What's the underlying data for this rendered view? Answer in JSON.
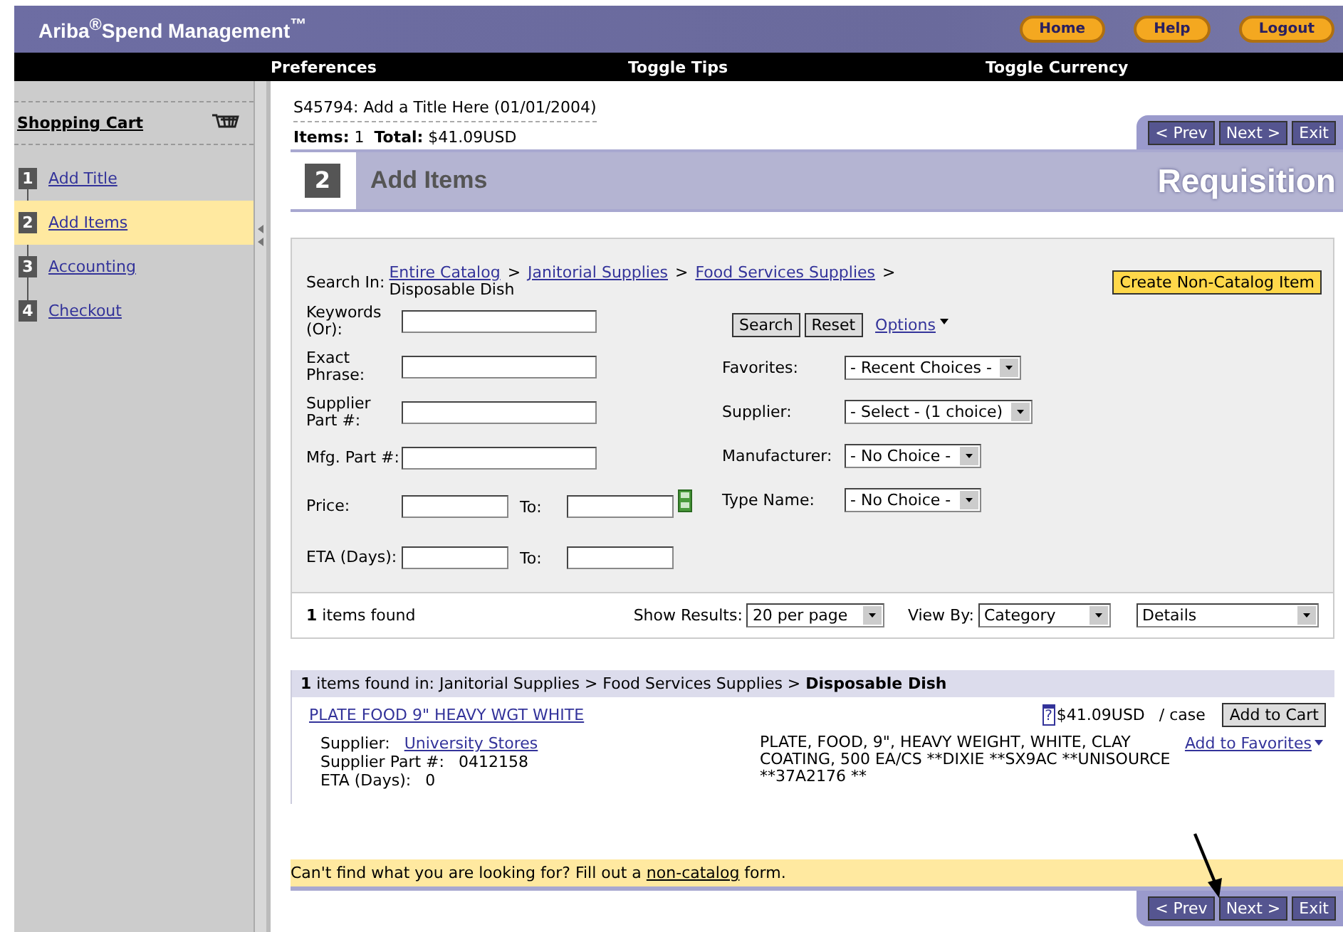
{
  "header": {
    "title": "Ariba$^{®}$Spend Management$^{™}$",
    "buttons": [
      "Home",
      "Help",
      "Logout"
    ]
  },
  "nav_bar": [
    "Preferences",
    "Toggle Tips",
    "Toggle Currency"
  ],
  "sidebar": {
    "title": "Shopping Cart",
    "steps": [
      {
        "number": "1",
        "label": "Add Title",
        "selected": false
      },
      {
        "number": "2",
        "label": "Add Items",
        "selected": true
      },
      {
        "number": "3",
        "label": "Accounting",
        "selected": false
      },
      {
        "number": "4",
        "label": "Checkout",
        "selected": false
      }
    ]
  },
  "document": {
    "title": "S45794: Add a Title Here (01/01/2004)",
    "summary": "**Items:** 1  **Total:** $41.09USD",
    "top_nav": [
      "< Prev",
      "Next >",
      "Exit"
    ]
  },
  "step_header": {
    "number": "2",
    "title": "Add Items",
    "section": "Requisition"
  },
  "search": {
    "search_in_label": "Search In:",
    "path": [
      {
        "text": "Entire Catalog",
        "kind": "link"
      },
      {
        "text": ">",
        "kind": "separator"
      },
      {
        "text": "Janitorial Supplies",
        "kind": "link"
      },
      {
        "text": ">",
        "kind": "separator"
      },
      {
        "text": "Food Services Supplies",
        "kind": "link"
      },
      {
        "text": ">",
        "kind": "separator"
      },
      {
        "text": "Disposable Dish",
        "kind": "text"
      }
    ],
    "create_button": "Create Non-Catalog Item",
    "fields": [
      {
        "label": "Keywords (Or):",
        "kind": "single"
      },
      {
        "label": "Exact Phrase:",
        "kind": "single"
      },
      {
        "label": "Supplier Part #:",
        "kind": "single"
      },
      {
        "label": "Mfg. Part #:",
        "kind": "single"
      },
      {
        "label": "Price:",
        "kind": "range",
        "to_label": "To:",
        "calendar": true
      },
      {
        "label": "ETA (Days):",
        "kind": "range",
        "to_label": "To:",
        "calendar": false
      }
    ],
    "buttons": [
      "Search",
      "Reset"
    ],
    "options_link": "Options",
    "filters": [
      {
        "label": "Favorites:",
        "value": "- Recent Choices -"
      },
      {
        "label": "Supplier:",
        "value": "- Select - (1 choice)"
      },
      {
        "label": "Manufacturer:",
        "value": "- No Choice -"
      },
      {
        "label": "Type Name:",
        "value": "- No Choice -"
      }
    ],
    "count": "**1** items found",
    "show_results": {
      "label": "Show Results:",
      "value": "20 per page"
    },
    "view_by": {
      "label": "View By:",
      "value": "Category",
      "detail": "Details"
    }
  },
  "results": {
    "heading": "**1** items found in: Janitorial Supplies > Food Services Supplies > **Disposable Dish**",
    "items": [
      {
        "name": "PLATE FOOD 9\" HEAVY WGT WHITE",
        "help_icon": "?",
        "price": "$41.09USD",
        "unit": "/ case",
        "add_button": "Add to Cart",
        "details": [
          {
            "label": "Supplier:",
            "value": "University Stores",
            "kind": "link"
          },
          {
            "label": "Supplier Part #:",
            "value": "0412158",
            "kind": "text"
          },
          {
            "label": "ETA (Days):",
            "value": "0",
            "kind": "text"
          }
        ],
        "description": "PLATE, FOOD, 9\", HEAVY WEIGHT, WHITE, CLAY COATING, 500 EA/CS **DIXIE **SX9AC **UNISOURCE **37A2176 **",
        "favorites_link": "Add to Favorites"
      }
    ]
  },
  "notice": {
    "before": "Can't find what you are looking for? Fill out a",
    "link": "non-catalog",
    "after": "form."
  },
  "bottom_nav": [
    "< Prev",
    "Next >",
    "Exit"
  ]
}
